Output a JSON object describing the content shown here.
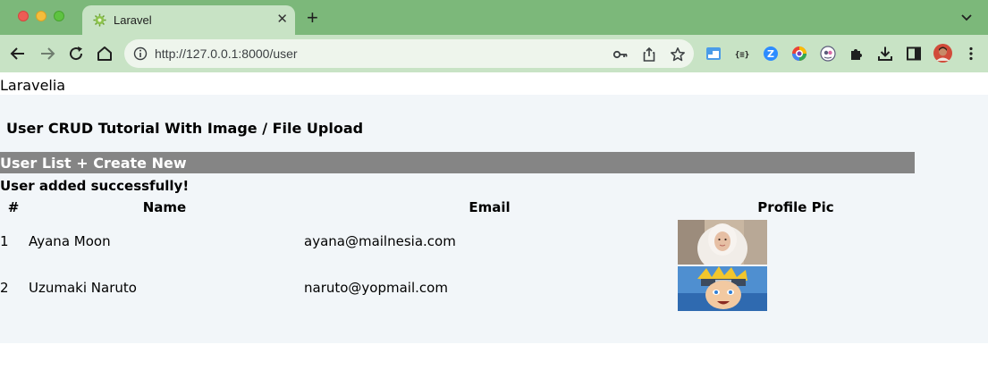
{
  "browser": {
    "tab_title": "Laravel",
    "tab_close": "✕",
    "new_tab": "+",
    "url": "http://127.0.0.1:8000/user"
  },
  "page": {
    "brand": "Laravelia",
    "heading": "User CRUD Tutorial With Image / File Upload",
    "list_bar": "User List + Create New",
    "flash": "User added successfully!",
    "table": {
      "headers": [
        "#",
        "Name",
        "Email",
        "Profile Pic"
      ],
      "rows": [
        {
          "num": "1",
          "name": "Ayana Moon",
          "email": "ayana@mailnesia.com"
        },
        {
          "num": "2",
          "name": "Uzumaki Naruto",
          "email": "naruto@yopmail.com"
        }
      ]
    }
  },
  "colors": {
    "tabbar": "#7cb87a",
    "toolbar": "#c8e3c5",
    "content_bg": "#f2f6f9",
    "list_bar": "#858585"
  }
}
